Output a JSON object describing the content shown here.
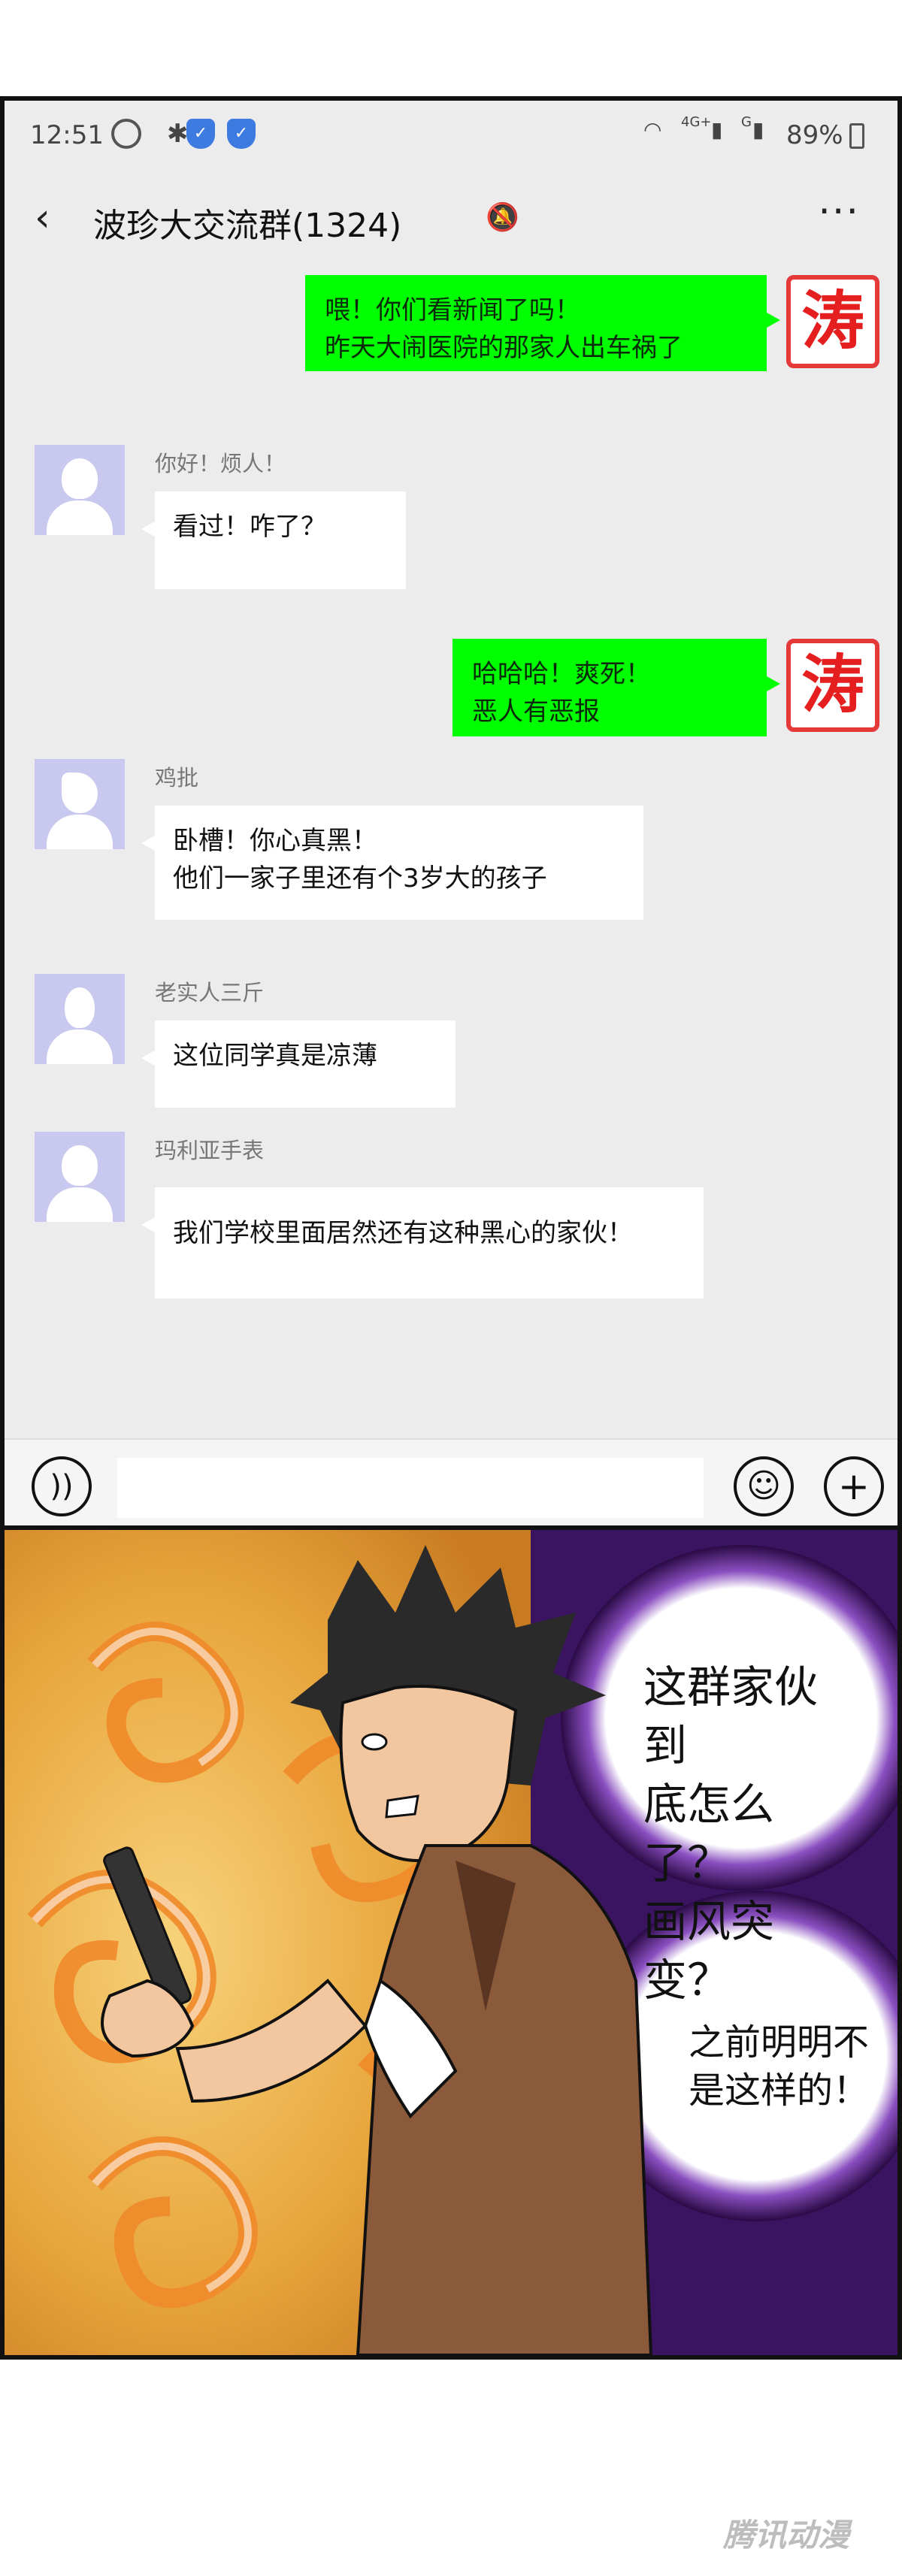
{
  "status_bar": {
    "time": "12:51",
    "network": "4G+",
    "signal2": "G",
    "battery": "89%"
  },
  "chat": {
    "title": "波珍大交流群(1324)",
    "messages": [
      {
        "side": "right",
        "avatar_text": "涛",
        "lines": [
          "喂！你们看新闻了吗！",
          "昨天大闹医院的那家人出车祸了"
        ]
      },
      {
        "side": "left",
        "nick": "你好！烦人！",
        "lines": [
          "看过！咋了？"
        ]
      },
      {
        "side": "right",
        "avatar_text": "涛",
        "lines": [
          "哈哈哈！爽死！",
          "恶人有恶报"
        ]
      },
      {
        "side": "left",
        "nick": "鸡批",
        "lines": [
          "卧槽！你心真黑！",
          "他们一家子里还有个3岁大的孩子"
        ]
      },
      {
        "side": "left",
        "nick": "老实人三斤",
        "lines": [
          "这位同学真是凉薄"
        ]
      },
      {
        "side": "left",
        "nick": "玛利亚手表",
        "lines": [
          "我们学校里面居然还有这种黑心的家伙！"
        ]
      }
    ]
  },
  "manga": {
    "speech_1": [
      "这群家伙到",
      "底怎么了？",
      "画风突变？"
    ],
    "speech_2": [
      "之前明明不",
      "是这样的！"
    ]
  },
  "watermark": "腾讯动漫",
  "colors": {
    "chat_bg": "#ececec",
    "my_bubble": "#00ff00",
    "tao_red": "#e51f1f",
    "avatar_purple": "#c9c8ee",
    "aura_purple": "#4a1a7a"
  },
  "icons": [
    "back-arrow-icon",
    "bell-muted-icon",
    "more-icon",
    "voice-icon",
    "emoji-icon",
    "plus-icon",
    "alarm-icon",
    "bluetooth-icon",
    "wifi-icon",
    "battery-icon"
  ]
}
